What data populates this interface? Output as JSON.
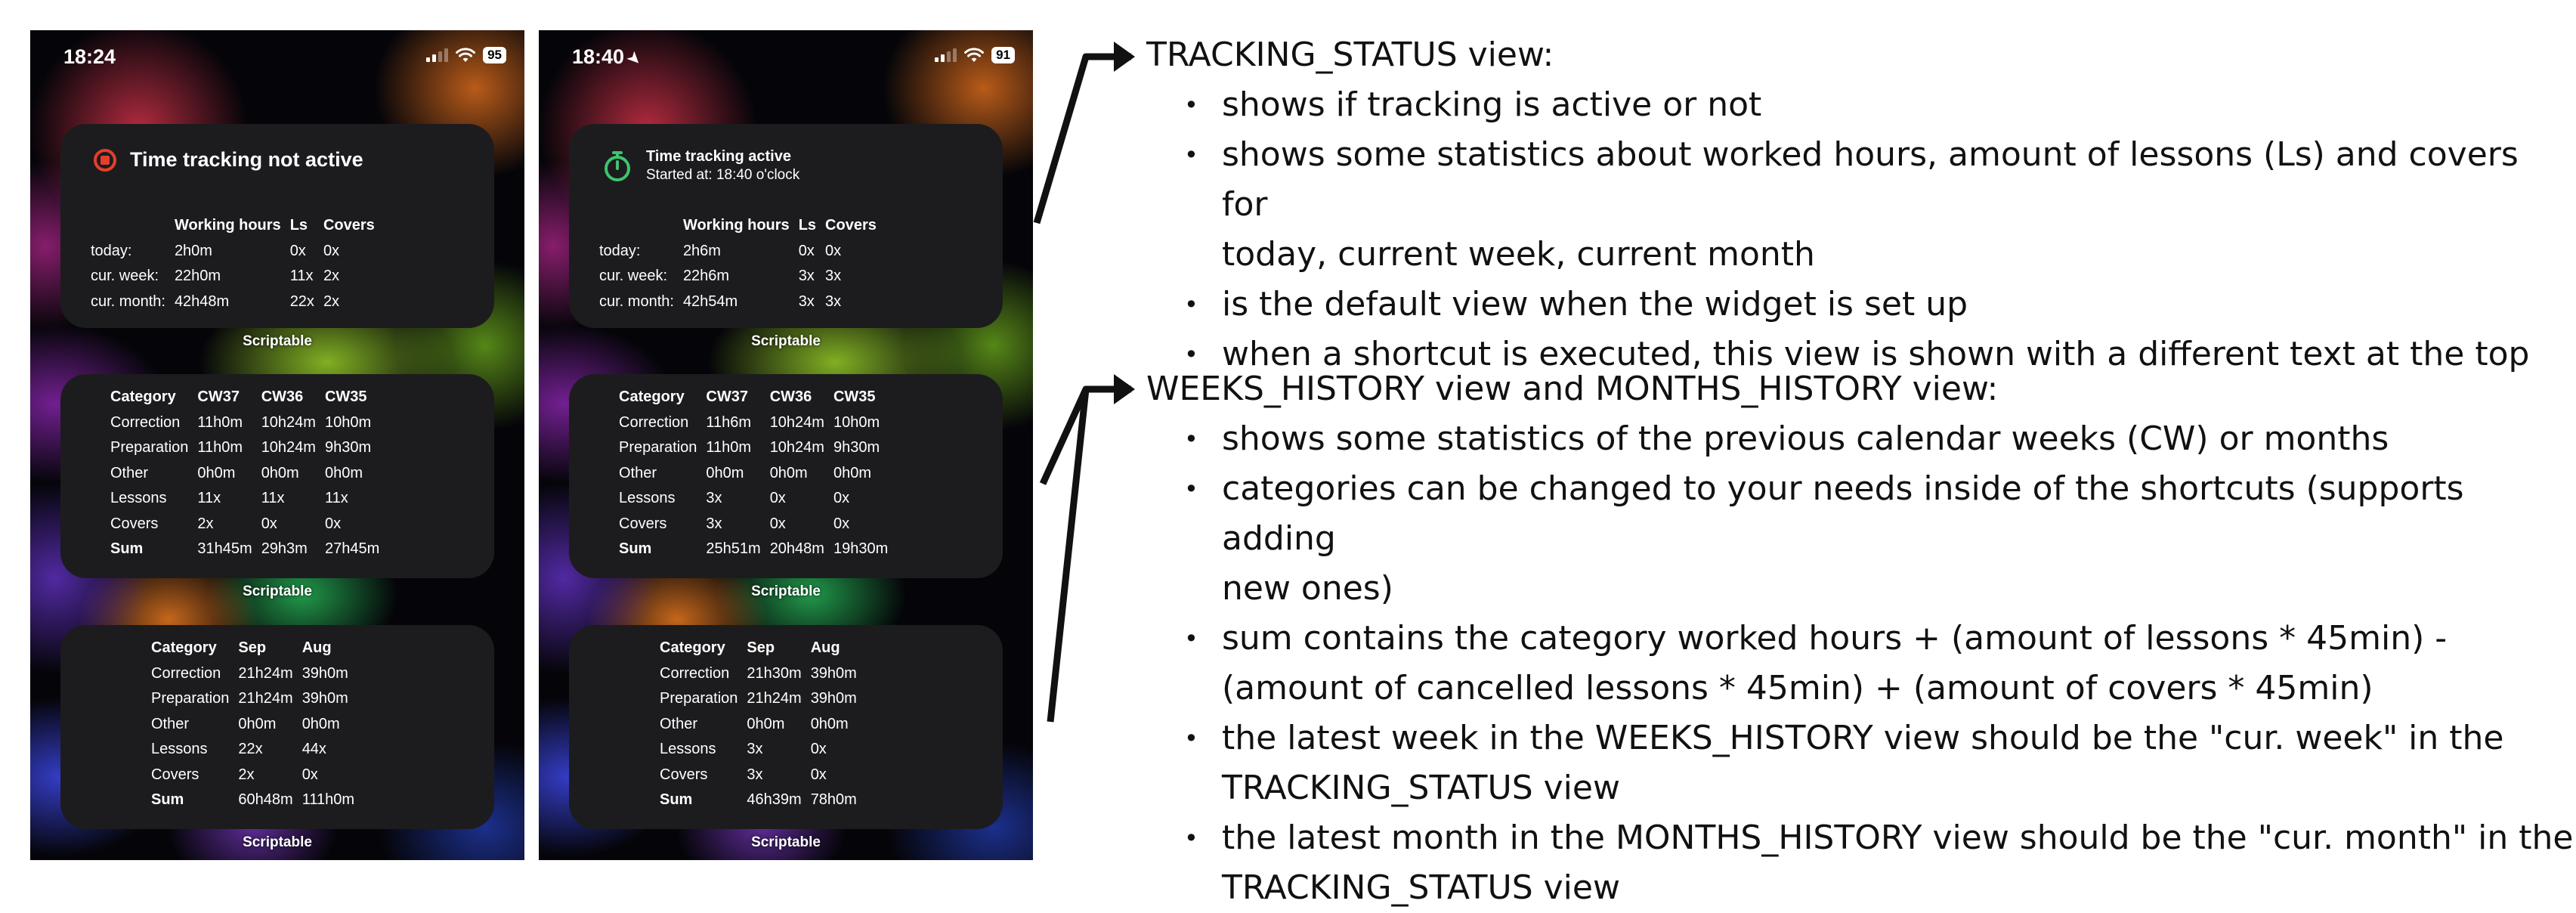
{
  "phones": [
    {
      "status_bar": {
        "time": "18:24",
        "battery": "95",
        "location_arrow": false
      },
      "status_widget": {
        "title": "Time tracking not active",
        "subtitle": "",
        "icon": "stop-circle-icon",
        "headers": [
          "",
          "Working hours",
          "Ls",
          "Covers"
        ],
        "rows": [
          {
            "label": "today:",
            "hours": "2h0m",
            "ls": "0x",
            "covers": "0x"
          },
          {
            "label": "cur. week:",
            "hours": "22h0m",
            "ls": "11x",
            "covers": "2x"
          },
          {
            "label": "cur. month:",
            "hours": "42h48m",
            "ls": "22x",
            "covers": "2x"
          }
        ]
      },
      "weeks_widget": {
        "headers": [
          "Category",
          "CW37",
          "CW36",
          "CW35"
        ],
        "rows": [
          [
            "Correction",
            "11h0m",
            "10h24m",
            "10h0m"
          ],
          [
            "Preparation",
            "11h0m",
            "10h24m",
            "9h30m"
          ],
          [
            "Other",
            "0h0m",
            "0h0m",
            "0h0m"
          ],
          [
            "Lessons",
            "11x",
            "11x",
            "11x"
          ],
          [
            "Covers",
            "2x",
            "0x",
            "0x"
          ],
          [
            "Sum",
            "31h45m",
            "29h3m",
            "27h45m"
          ]
        ]
      },
      "months_widget": {
        "headers": [
          "Category",
          "Sep",
          "Aug"
        ],
        "rows": [
          [
            "Correction",
            "21h24m",
            "39h0m"
          ],
          [
            "Preparation",
            "21h24m",
            "39h0m"
          ],
          [
            "Other",
            "0h0m",
            "0h0m"
          ],
          [
            "Lessons",
            "22x",
            "44x"
          ],
          [
            "Covers",
            "2x",
            "0x"
          ],
          [
            "Sum",
            "60h48m",
            "111h0m"
          ]
        ]
      },
      "scriptable_label": "Scriptable"
    },
    {
      "status_bar": {
        "time": "18:40",
        "battery": "91",
        "location_arrow": true
      },
      "status_widget": {
        "title": "Time tracking active",
        "subtitle": "Started at: 18:40 o'clock",
        "icon": "stopwatch-icon",
        "headers": [
          "",
          "Working hours",
          "Ls",
          "Covers"
        ],
        "rows": [
          {
            "label": "today:",
            "hours": "2h6m",
            "ls": "0x",
            "covers": "0x"
          },
          {
            "label": "cur. week:",
            "hours": "22h6m",
            "ls": "3x",
            "covers": "3x"
          },
          {
            "label": "cur. month:",
            "hours": "42h54m",
            "ls": "3x",
            "covers": "3x"
          }
        ]
      },
      "weeks_widget": {
        "headers": [
          "Category",
          "CW37",
          "CW36",
          "CW35"
        ],
        "rows": [
          [
            "Correction",
            "11h6m",
            "10h24m",
            "10h0m"
          ],
          [
            "Preparation",
            "11h0m",
            "10h24m",
            "9h30m"
          ],
          [
            "Other",
            "0h0m",
            "0h0m",
            "0h0m"
          ],
          [
            "Lessons",
            "3x",
            "0x",
            "0x"
          ],
          [
            "Covers",
            "3x",
            "0x",
            "0x"
          ],
          [
            "Sum",
            "25h51m",
            "20h48m",
            "19h30m"
          ]
        ]
      },
      "months_widget": {
        "headers": [
          "Category",
          "Sep",
          "Aug"
        ],
        "rows": [
          [
            "Correction",
            "21h30m",
            "39h0m"
          ],
          [
            "Preparation",
            "21h24m",
            "39h0m"
          ],
          [
            "Other",
            "0h0m",
            "0h0m"
          ],
          [
            "Lessons",
            "3x",
            "0x"
          ],
          [
            "Covers",
            "3x",
            "0x"
          ],
          [
            "Sum",
            "46h39m",
            "78h0m"
          ]
        ]
      },
      "scriptable_label": "Scriptable"
    }
  ],
  "annotations": [
    {
      "title": "TRACKING_STATUS view:",
      "bullets": [
        "shows if tracking is active or not",
        "shows some statistics about worked hours, amount of lessons (Ls) and covers for",
        "today, current week, current month",
        "is the default view when the widget is set up",
        "when a shortcut is executed, this view is shown with a different text at the top"
      ]
    },
    {
      "title": "WEEKS_HISTORY view and MONTHS_HISTORY view:",
      "bullets": [
        "shows some statistics of the previous calendar weeks (CW) or months",
        "categories can be changed to your needs inside of the shortcuts (supports adding",
        "new ones)",
        "sum contains the category worked hours + (amount of lessons * 45min) -",
        "(amount of cancelled lessons * 45min) + (amount of covers * 45min)",
        "the latest week in the WEEKS_HISTORY view should be the \"cur. week\" in the",
        "TRACKING_STATUS view",
        "the latest month in the MONTHS_HISTORY view should be the \"cur. month\" in the",
        "TRACKING_STATUS view"
      ],
      "continuation_lines": [
        2,
        4,
        6,
        8
      ]
    }
  ],
  "colors": {
    "widget_bg": "#1c1c1e",
    "stop_red": "#e53e2e",
    "stopwatch_green": "#3ec46d",
    "arrow": "#111111"
  }
}
